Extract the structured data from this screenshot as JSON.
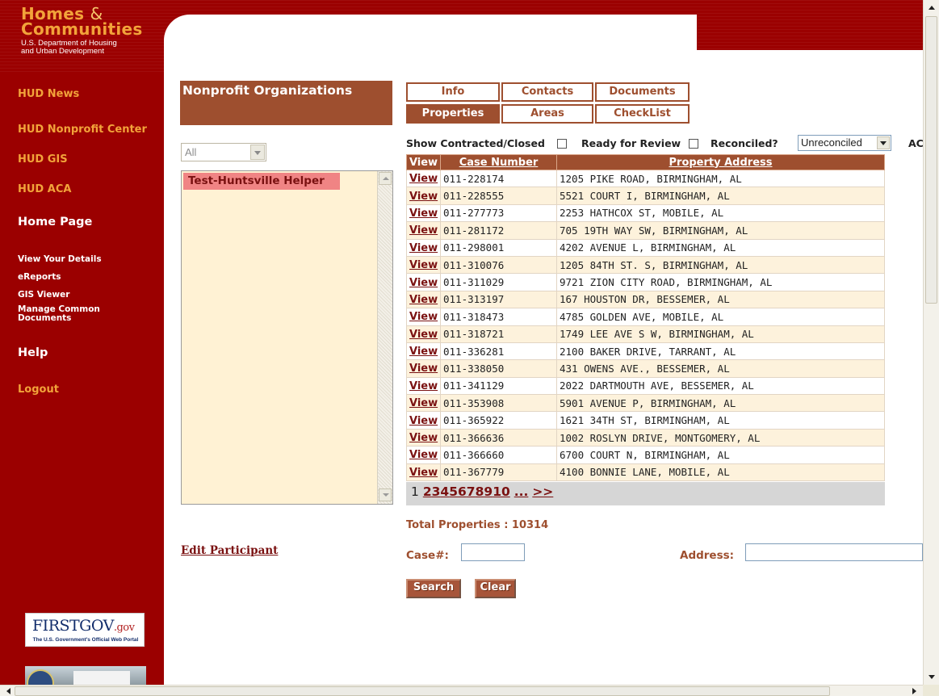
{
  "header": {
    "logo_line1": "Homes",
    "logo_amp": "&",
    "logo_line2": "Communities",
    "logo_sub1": "U.S. Department of Housing",
    "logo_sub2": "and Urban Development"
  },
  "sidebar": {
    "items": [
      {
        "label": "HUD News",
        "style": "orange"
      },
      {
        "label": "HUD Nonprofit Center",
        "style": "orange"
      },
      {
        "label": "HUD GIS",
        "style": "orange"
      },
      {
        "label": "HUD ACA",
        "style": "orange"
      },
      {
        "label": "Home Page",
        "style": "white"
      },
      {
        "label": "View Your Details",
        "style": "small"
      },
      {
        "label": "eReports",
        "style": "small"
      },
      {
        "label": "GIS Viewer",
        "style": "small"
      },
      {
        "label": "Manage Common",
        "style": "small"
      },
      {
        "label": "Documents",
        "style": "small"
      },
      {
        "label": "Help",
        "style": "white"
      },
      {
        "label": "Logout",
        "style": "orange"
      }
    ],
    "firstgov": {
      "text": "FIRSTGOV",
      "gov": ".gov",
      "sub": "The U.S. Government's Official Web Portal"
    }
  },
  "nonprofit": {
    "title": "Nonprofit Organizations",
    "filter_value": "All",
    "selected_org": "Test-Huntsville Helper",
    "edit_link": "Edit Participant"
  },
  "tabs": [
    {
      "label": "Info",
      "active": false
    },
    {
      "label": "Contacts",
      "active": false
    },
    {
      "label": "Documents",
      "active": false
    },
    {
      "label": "Properties",
      "active": true
    },
    {
      "label": "Areas",
      "active": false
    },
    {
      "label": "CheckList",
      "active": false
    }
  ],
  "filters": {
    "show_contracted": "Show Contracted/Closed",
    "ready_for_review": "Ready for Review",
    "reconciled": "Reconciled?",
    "reconciled_value": "Unreconciled",
    "trailing": "AC"
  },
  "table": {
    "columns": [
      "View",
      "Case Number",
      "Property Address"
    ],
    "view_label": "View",
    "rows": [
      {
        "case": "011-228174",
        "address": "1205 PIKE ROAD, BIRMINGHAM, AL"
      },
      {
        "case": "011-228555",
        "address": "5521 COURT I, BIRMINGHAM, AL"
      },
      {
        "case": "011-277773",
        "address": "2253 HATHCOX ST, MOBILE, AL"
      },
      {
        "case": "011-281172",
        "address": "705 19TH WAY SW, BIRMINGHAM, AL"
      },
      {
        "case": "011-298001",
        "address": "4202 AVENUE L, BIRMINGHAM, AL"
      },
      {
        "case": "011-310076",
        "address": "1205 84TH ST. S, BIRMINGHAM, AL"
      },
      {
        "case": "011-311029",
        "address": "9721 ZION CITY ROAD, BIRMINGHAM, AL"
      },
      {
        "case": "011-313197",
        "address": "167 HOUSTON DR, BESSEMER, AL"
      },
      {
        "case": "011-318473",
        "address": "4785 GOLDEN AVE, MOBILE, AL"
      },
      {
        "case": "011-318721",
        "address": "1749 LEE AVE S W, BIRMINGHAM, AL"
      },
      {
        "case": "011-336281",
        "address": "2100 BAKER DRIVE, TARRANT, AL"
      },
      {
        "case": "011-338050",
        "address": "431 OWENS AVE., BESSEMER, AL"
      },
      {
        "case": "011-341129",
        "address": "2022 DARTMOUTH AVE, BESSEMER, AL"
      },
      {
        "case": "011-353908",
        "address": "5901 AVENUE P, BIRMINGHAM, AL"
      },
      {
        "case": "011-365922",
        "address": "1621 34TH ST, BIRMINGHAM, AL"
      },
      {
        "case": "011-366636",
        "address": "1002 ROSLYN DRIVE, MONTGOMERY, AL"
      },
      {
        "case": "011-366660",
        "address": "6700 COURT N, BIRMINGHAM, AL"
      },
      {
        "case": "011-367779",
        "address": "4100 BONNIE LANE, MOBILE, AL"
      }
    ]
  },
  "pager": {
    "current": "1",
    "pages": [
      "2",
      "3",
      "4",
      "5",
      "6",
      "7",
      "8",
      "9",
      "10"
    ],
    "more": "...",
    "next": ">>"
  },
  "search": {
    "total": "Total Properties : 10314",
    "case_label": "Case#:",
    "address_label": "Address:",
    "case_value": "",
    "address_value": "",
    "search_button": "Search",
    "clear_button": "Clear"
  },
  "colors": {
    "brand_red": "#9b0000",
    "accent_brown": "#9e4f2f",
    "logo_orange": "#f2a33a",
    "row_alt": "#fdf2dc",
    "selected_org": "#f08484"
  }
}
